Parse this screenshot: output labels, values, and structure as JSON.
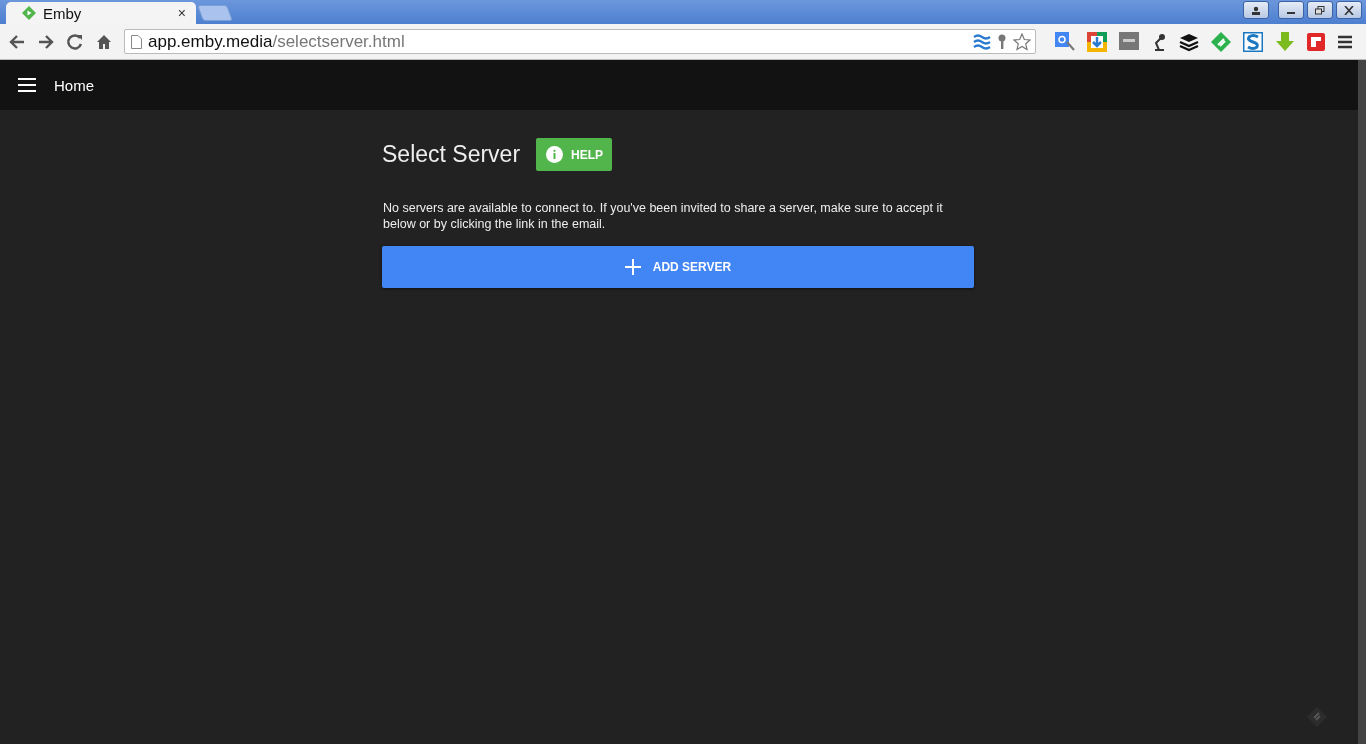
{
  "browser": {
    "tab_title": "Emby",
    "tab_close": "×",
    "url_host": "app.emby.media",
    "url_path": "/selectserver.html"
  },
  "header": {
    "title": "Home"
  },
  "page": {
    "title": "Select Server",
    "help_button": "HELP",
    "message": "No servers are available to connect to. If you've been invited to share a server, make sure to accept it below or by clicking the link in the email.",
    "add_button": "ADD SERVER"
  }
}
